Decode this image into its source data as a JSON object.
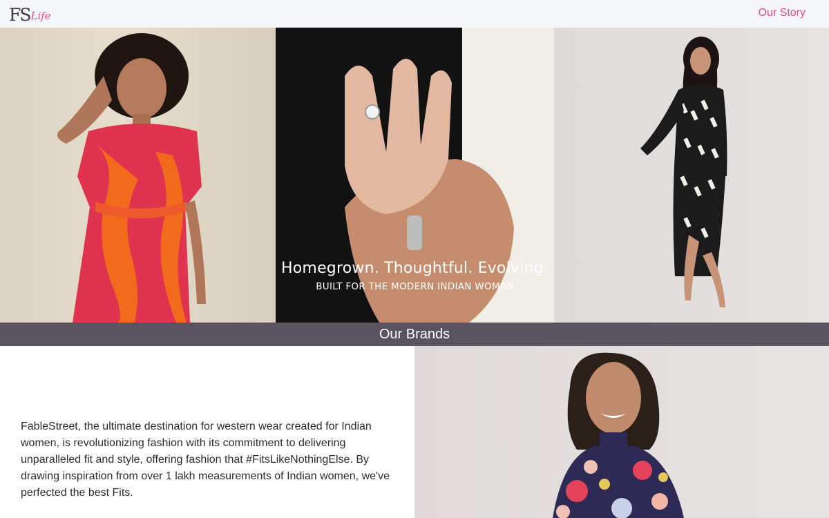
{
  "header": {
    "logo_main": "FS",
    "logo_script": "Life",
    "nav_link": "Our Story"
  },
  "hero": {
    "title": "Homegrown. Thoughtful. Evolving.",
    "subtitle": "BUILT FOR THE MODERN INDIAN WOMAN"
  },
  "brands": {
    "heading": "Our Brands",
    "description": "FableStreet, the ultimate destination for western wear created for Indian women, is revolutionizing fashion with its commitment to delivering unparalleled fit and style, offering fashion that #FitsLikeNothingElse. By drawing inspiration from over 1 lakh measurements of Indian women, we've perfected the best Fits."
  },
  "colors": {
    "accent": "#e8487a",
    "header_bg": "#f5f6f9",
    "brands_bar": "#5a5461",
    "text": "#2b2b2b"
  }
}
